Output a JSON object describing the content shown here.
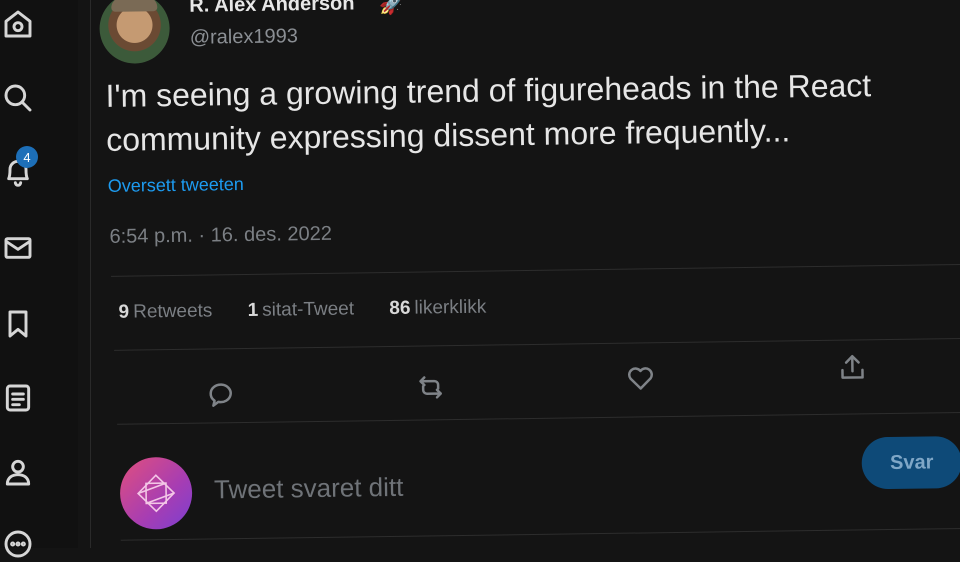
{
  "sidebar": {
    "items": [
      {
        "icon": "home-icon"
      },
      {
        "icon": "search-icon"
      },
      {
        "icon": "bell-icon",
        "badge": "4"
      },
      {
        "icon": "mail-icon"
      },
      {
        "icon": "bookmark-icon"
      },
      {
        "icon": "list-icon"
      },
      {
        "icon": "profile-icon"
      },
      {
        "icon": "more-icon"
      }
    ]
  },
  "tweet": {
    "author_name": "R. Alex Anderson",
    "author_emoji": "🚀",
    "handle": "@ralex1993",
    "text": "I'm seeing a growing trend of figureheads in the React community expressing dissent more frequently...",
    "translate_label": "Oversett tweeten",
    "timestamp": "6:54 p.m. · 16. des. 2022",
    "stats": {
      "retweets_count": "9",
      "retweets_label": "Retweets",
      "quotes_count": "1",
      "quotes_label": "sitat-Tweet",
      "likes_count": "86",
      "likes_label": "likerklikk"
    }
  },
  "reply": {
    "placeholder": "Tweet svaret ditt",
    "button_label": "Svar"
  },
  "colors": {
    "background": "#141414",
    "accent": "#1d9bf0",
    "button_bg": "#0e4a78"
  }
}
